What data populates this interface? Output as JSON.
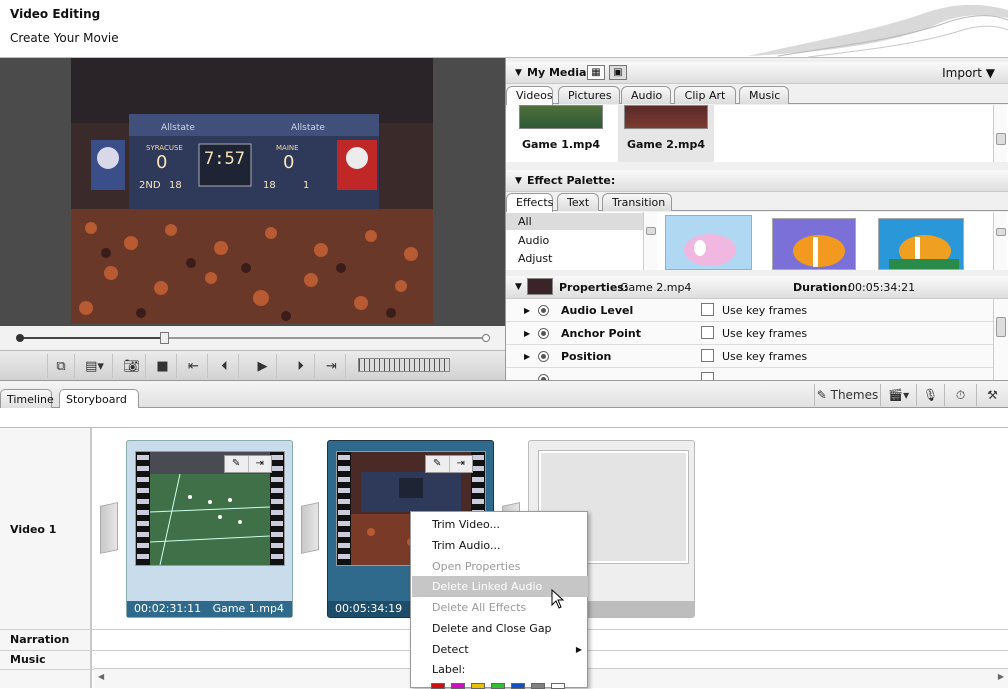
{
  "header": {
    "title": "Video Editing",
    "subtitle": "Create Your Movie"
  },
  "viewer": {
    "scoreboard": {
      "home": "SYRACUSE",
      "away": "MAINE",
      "home_score": "0",
      "away_score": "0",
      "clock": "7:57",
      "down": "2ND",
      "to_go": "18",
      "ball_on": "18",
      "quarter": "1",
      "sponsor": "Allstate"
    },
    "position_fraction": 0.31
  },
  "my_media": {
    "title": "My Media",
    "import_label": "Import",
    "tabs": [
      "Videos",
      "Pictures",
      "Audio",
      "Clip Art",
      "Music"
    ],
    "active_tab": "Videos",
    "items": [
      {
        "label": "Game 1.mp4"
      },
      {
        "label": "Game 2.mp4"
      }
    ]
  },
  "effect_palette": {
    "title": "Effect Palette:",
    "tabs": [
      "Effects",
      "Text",
      "Transition"
    ],
    "active_tab": "Effects",
    "categories": [
      "All",
      "Audio",
      "Adjust"
    ]
  },
  "properties": {
    "title": "Properties:",
    "clip_name": "Game 2.mp4",
    "duration_label": "Duration:",
    "duration_value": "00:05:34:21",
    "rows": [
      {
        "name": "Audio Level",
        "keyframes_label": "Use key frames"
      },
      {
        "name": "Anchor Point",
        "keyframes_label": "Use key frames"
      },
      {
        "name": "Position",
        "keyframes_label": "Use key frames"
      }
    ]
  },
  "bottom_tabs": {
    "tabs": [
      "Timeline",
      "Storyboard"
    ],
    "active": "Storyboard"
  },
  "toolbar": {
    "themes_label": "Themes"
  },
  "tracks": {
    "video": "Video 1",
    "narration": "Narration",
    "music": "Music"
  },
  "clips": [
    {
      "time": "00:02:31:11",
      "name": "Game 1.mp4"
    },
    {
      "time": "00:05:34:19",
      "name": ""
    }
  ],
  "context_menu": {
    "items": [
      {
        "label": "Trim Video...",
        "disabled": false
      },
      {
        "label": "Trim Audio...",
        "disabled": false
      },
      {
        "label": "Open Properties",
        "disabled": true
      },
      {
        "label": "Delete Linked Audio",
        "disabled": false,
        "highlighted": true
      },
      {
        "label": "Delete All Effects",
        "disabled": true
      },
      {
        "label": "Delete and Close Gap",
        "disabled": false
      },
      {
        "label": "Detect",
        "disabled": false,
        "submenu": true
      },
      {
        "label": "Label:",
        "disabled": false
      }
    ],
    "label_colors": [
      "#d01010",
      "#d010c0",
      "#e8c000",
      "#30c030",
      "#1050c0",
      "#808080",
      "#ffffff"
    ]
  },
  "colors": {
    "clip_selected": "#2f6a8c",
    "clip_normal": "#c8dcec",
    "menu_highlight": "#c6c6c6"
  }
}
